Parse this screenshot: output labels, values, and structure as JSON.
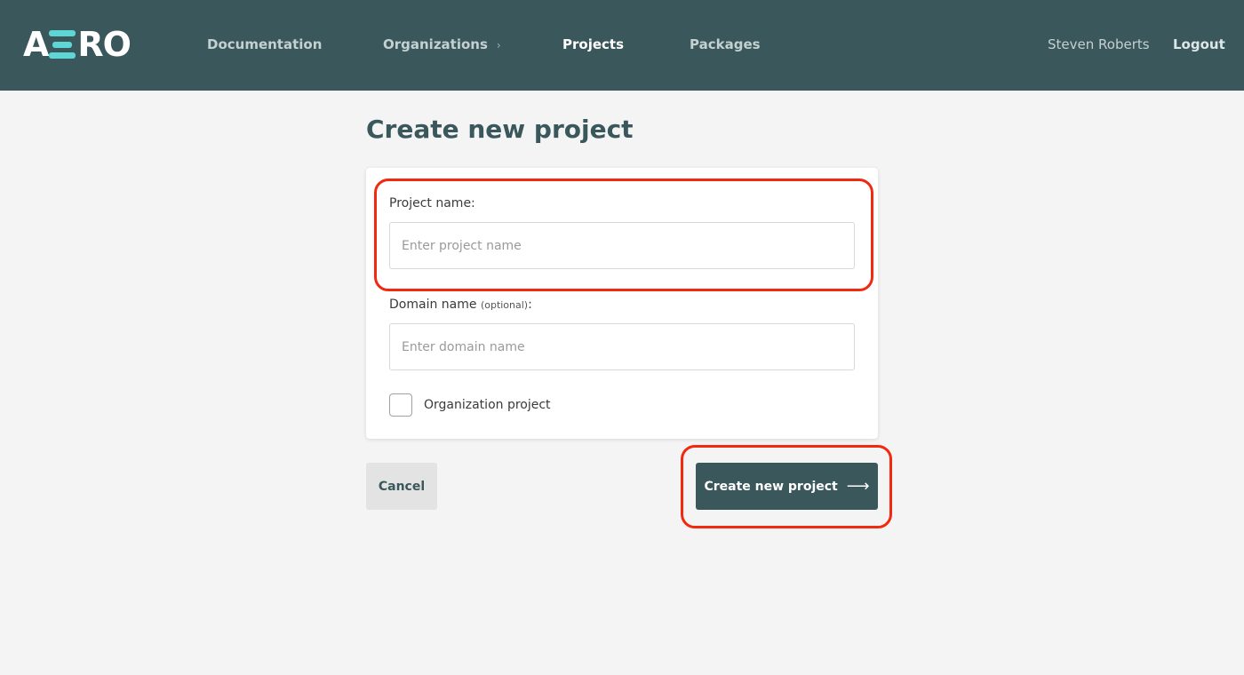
{
  "header": {
    "logo_text_start": "A",
    "logo_text_end": "RO",
    "nav": [
      {
        "label": "Documentation"
      },
      {
        "label": "Organizations",
        "chevron": "›"
      },
      {
        "label": "Projects",
        "active": true
      },
      {
        "label": "Packages"
      }
    ],
    "user_name": "Steven Roberts",
    "logout_label": "Logout"
  },
  "page": {
    "title": "Create new project"
  },
  "form": {
    "project_name_label": "Project name:",
    "project_name_placeholder": "Enter project name",
    "project_name_value": "",
    "domain_name_label": "Domain name",
    "domain_name_optional": "(optional)",
    "domain_name_colon": ":",
    "domain_name_placeholder": "Enter domain name",
    "domain_name_value": "",
    "organization_checkbox_label": "Organization project",
    "organization_checked": false
  },
  "actions": {
    "cancel_label": "Cancel",
    "create_label": "Create new project",
    "create_arrow": "⟶"
  },
  "colors": {
    "header_bg": "#3a575b",
    "accent": "#5fd6d6",
    "highlight": "#f2280f",
    "primary_button": "#3a575b"
  },
  "icons": {
    "create_arrow": "arrow-right-icon",
    "nav_chevron": "chevron-right-icon"
  }
}
